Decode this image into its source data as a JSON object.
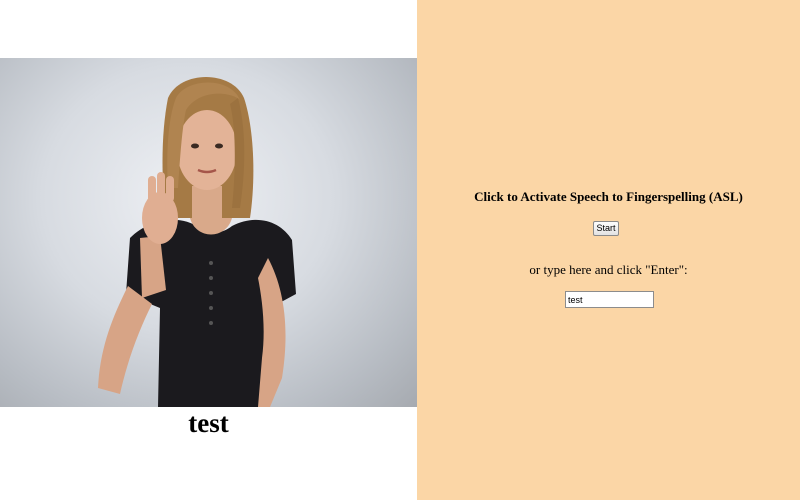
{
  "video": {
    "caption": "test"
  },
  "panel": {
    "instruction": "Click to Activate Speech to Fingerspelling (ASL)",
    "start_label": "Start",
    "type_prompt": "or type here and click \"Enter\":",
    "input_value": "test"
  },
  "colors": {
    "right_panel_bg": "#fbd6a6",
    "left_panel_bg": "#ffffff"
  }
}
